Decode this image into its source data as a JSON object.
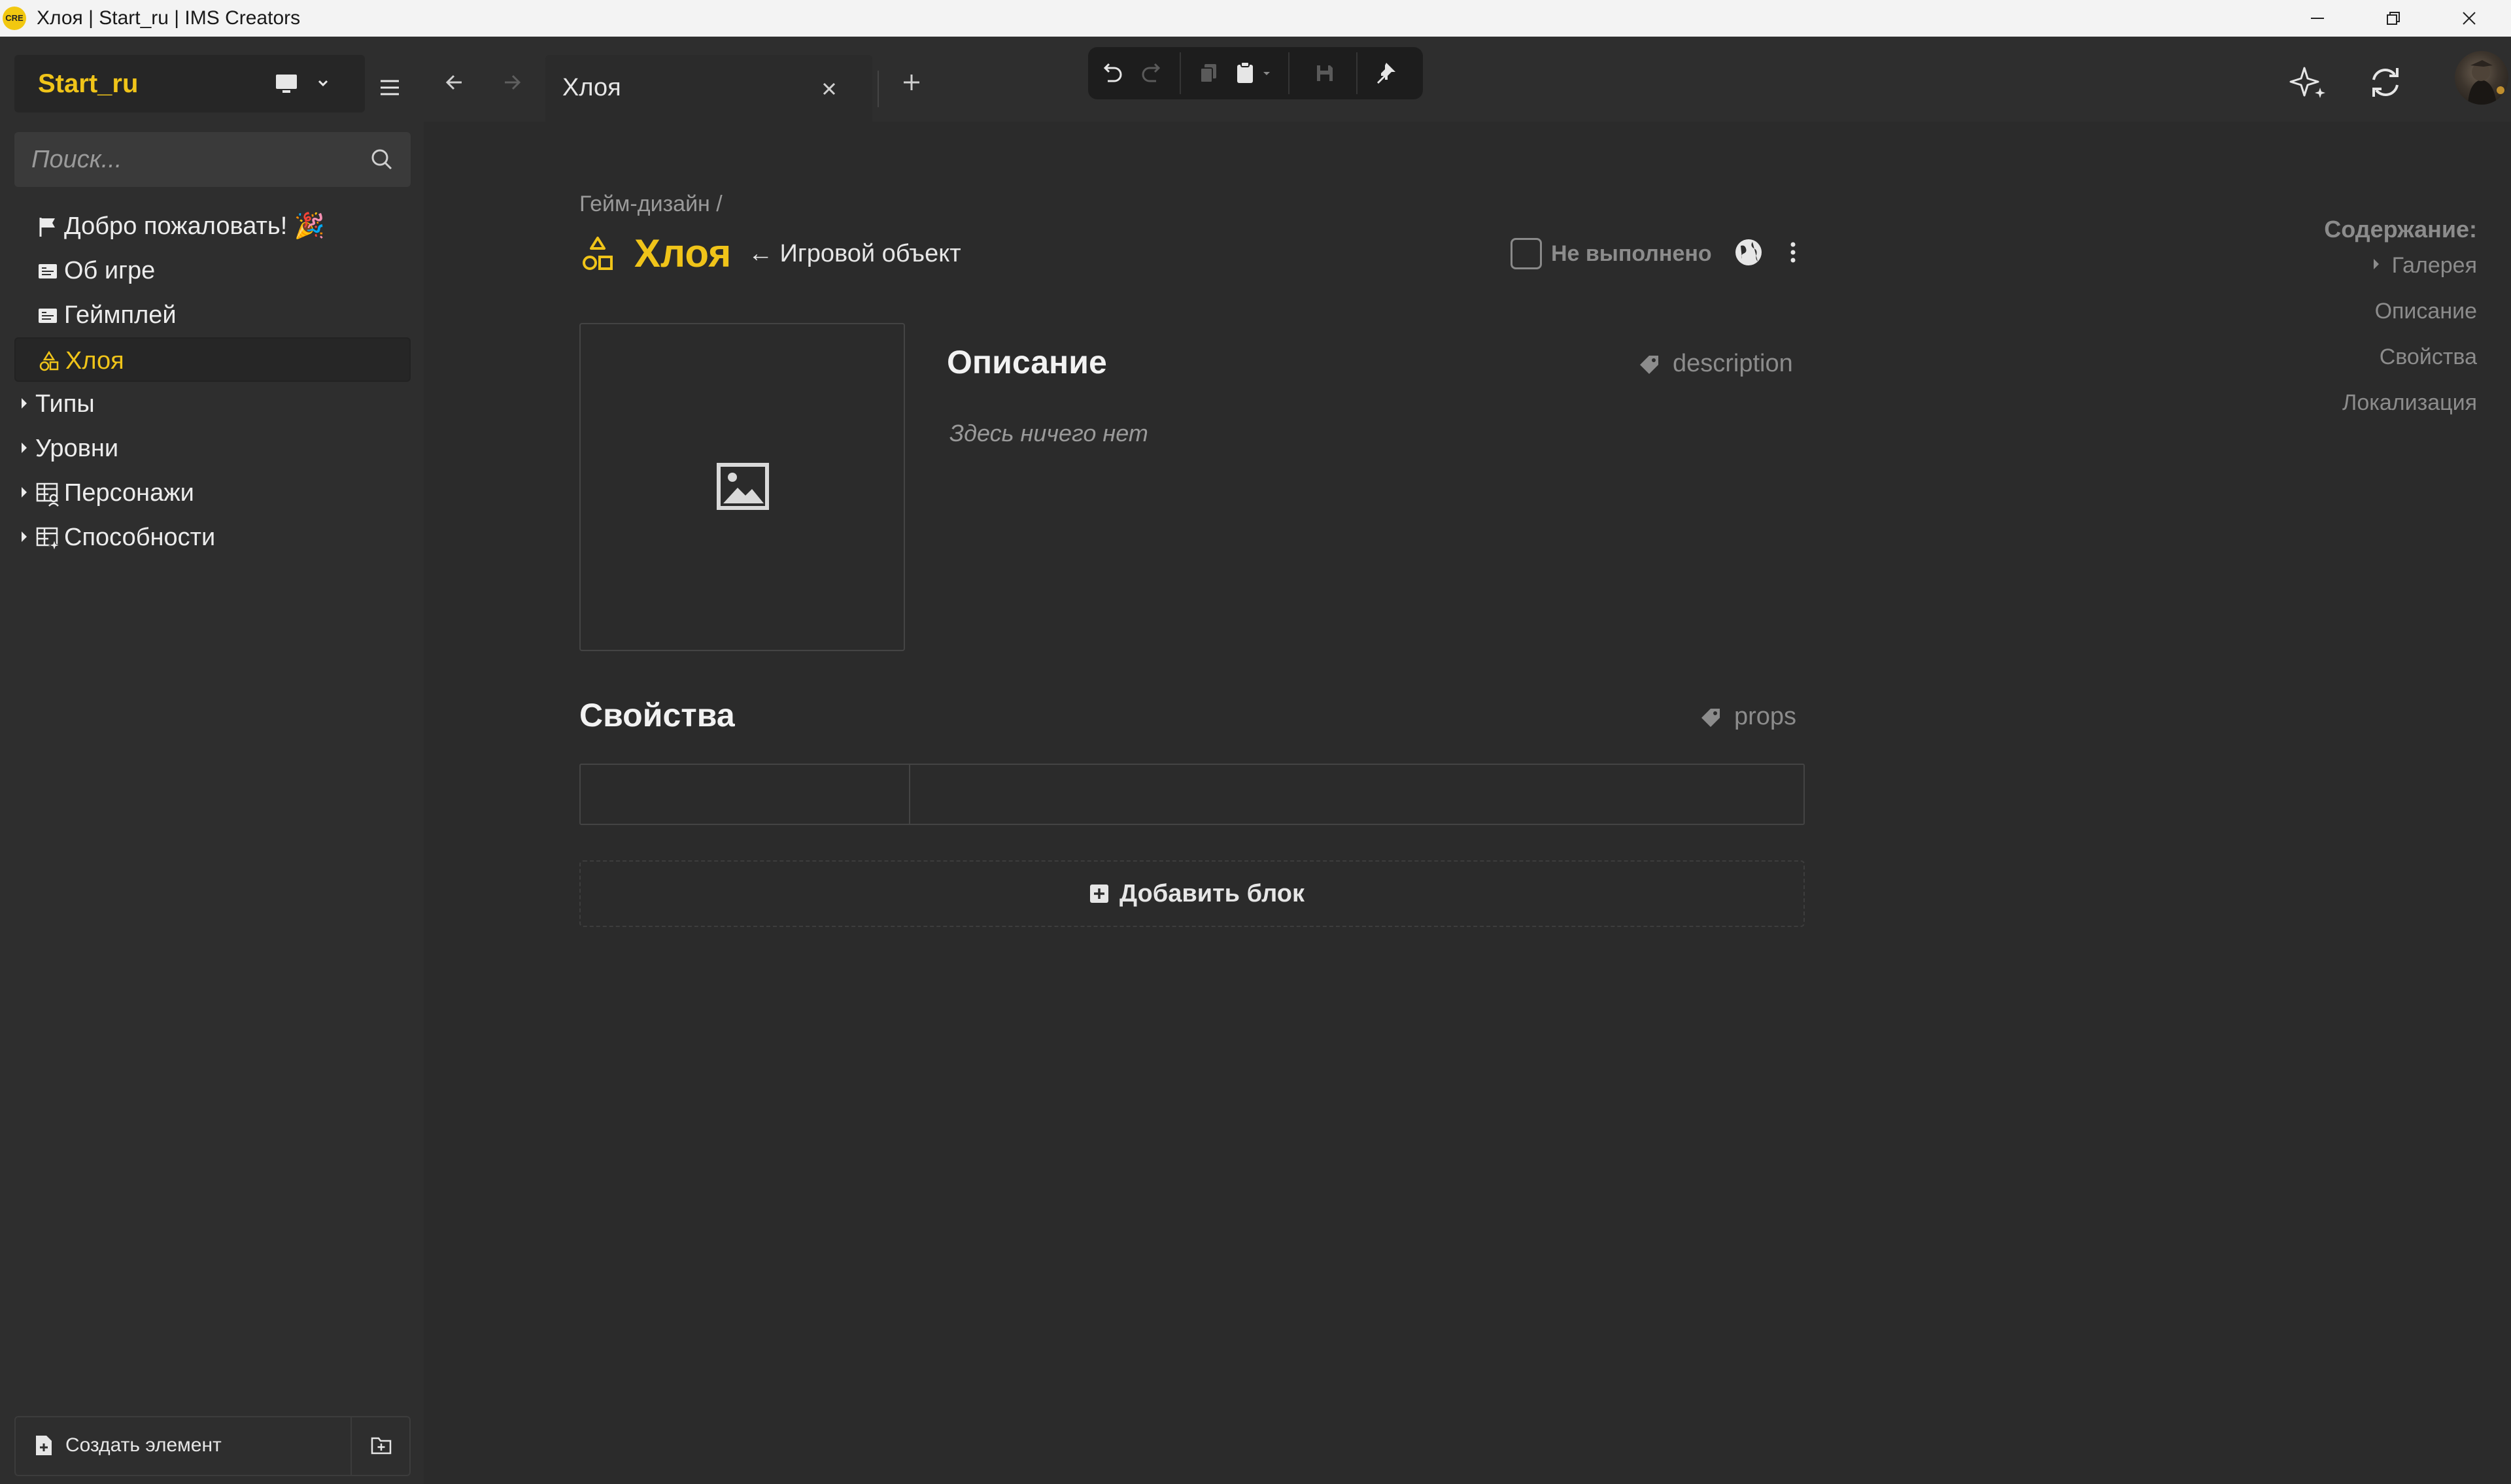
{
  "window": {
    "title": "Хлоя | Start_ru | IMS Creators",
    "app_logo": "CRE"
  },
  "sidebar": {
    "project_name": "Start_ru",
    "search_placeholder": "Поиск...",
    "items": [
      {
        "label": "Добро пожаловать! 🎉",
        "icon": "flag-icon",
        "active": false
      },
      {
        "label": "Об игре",
        "icon": "doc-icon",
        "active": false
      },
      {
        "label": "Геймплей",
        "icon": "doc-icon",
        "active": false
      },
      {
        "label": "Хлоя",
        "icon": "shapes-icon",
        "active": true
      }
    ],
    "folders": [
      {
        "label": "Типы",
        "icon": null
      },
      {
        "label": "Уровни",
        "icon": null
      },
      {
        "label": "Персонажи",
        "icon": "table-user-icon"
      },
      {
        "label": "Способности",
        "icon": "table-magic-icon"
      }
    ],
    "create_label": "Создать элемент"
  },
  "tabs": [
    {
      "label": "Хлоя",
      "active": true
    }
  ],
  "page": {
    "breadcrumb": "Гейм-дизайн /",
    "title": "Хлоя",
    "type_label": "← Игровой объект",
    "status_label": "Не выполнено",
    "status_checked": false,
    "description": {
      "heading": "Описание",
      "tag": "description",
      "empty_text": "Здесь ничего нет"
    },
    "properties": {
      "heading": "Свойства",
      "tag": "props"
    },
    "add_block_label": "Добавить блок"
  },
  "toc": {
    "title": "Содержание:",
    "items": [
      "Галерея",
      "Описание",
      "Свойства",
      "Локализация"
    ]
  },
  "colors": {
    "accent": "#f0c419",
    "background": "#2b2b2b",
    "sidebar": "#2e2e2e"
  }
}
